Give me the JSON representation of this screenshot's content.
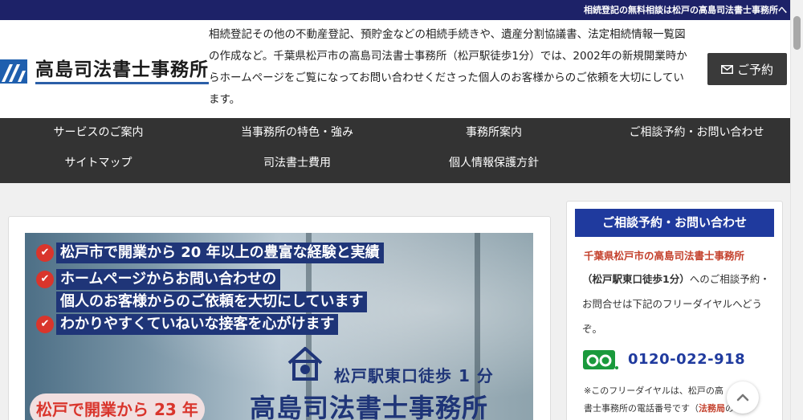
{
  "topbar": {
    "text": "相続登記の無料相談は松戸の高島司法書士事務所へ"
  },
  "header": {
    "logo_text": "高島司法書士事務所",
    "intro": "相続登記その他の不動産登記、預貯金などの相続手続きや、遺産分割協議書、法定相続情報一覧図の作成など。千葉県松戸市の高島司法書士事務所（松戸駅徒歩1分）では、2002年の新規開業時からホームページをご覧になってお問い合わせくださった個人のお客様からのご依頼を大切にしています。",
    "reserve_label": "ご予約"
  },
  "nav": {
    "items": [
      {
        "label": "サービスのご案内"
      },
      {
        "label": "当事務所の特色・強み"
      },
      {
        "label": "事務所案内"
      },
      {
        "label": "ご相談予約・お問い合わせ"
      },
      {
        "label": "サイトマップ"
      },
      {
        "label": "司法書士費用"
      },
      {
        "label": "個人情報保護方針"
      }
    ]
  },
  "banner": {
    "lines": [
      "松戸市で開業から 20 年以上の豊富な経験と実績",
      "ホームページからお問い合わせの",
      "個人のお客様からのご依頼を大切にしています",
      "わかりやすくていねいな接客を心がけます"
    ],
    "station": "松戸駅東口徒歩 1 分",
    "open_badge": "松戸で開業から 23 年",
    "office_name": "高島司法書士事務所"
  },
  "sidebar": {
    "title": "ご相談予約・お問い合わせ",
    "office": "千葉県松戸市の高島司法書士事務所",
    "desc_bold": "（松戸駅東口徒歩1分）",
    "desc_rest": "へのご相談予約・お問合せは下記のフリーダイヤルへどうぞ。",
    "phone": "0120-022-918",
    "note_prefix": "※このフリーダイヤルは、松戸の高",
    "note_mid": "書士事務所の電話番号です（",
    "note_red": "法務局",
    "note_end": "の"
  },
  "colors": {
    "navy": "#1d2268",
    "accent_blue": "#1f3a9e",
    "red": "#c4412d",
    "nav_bg": "#333333"
  }
}
